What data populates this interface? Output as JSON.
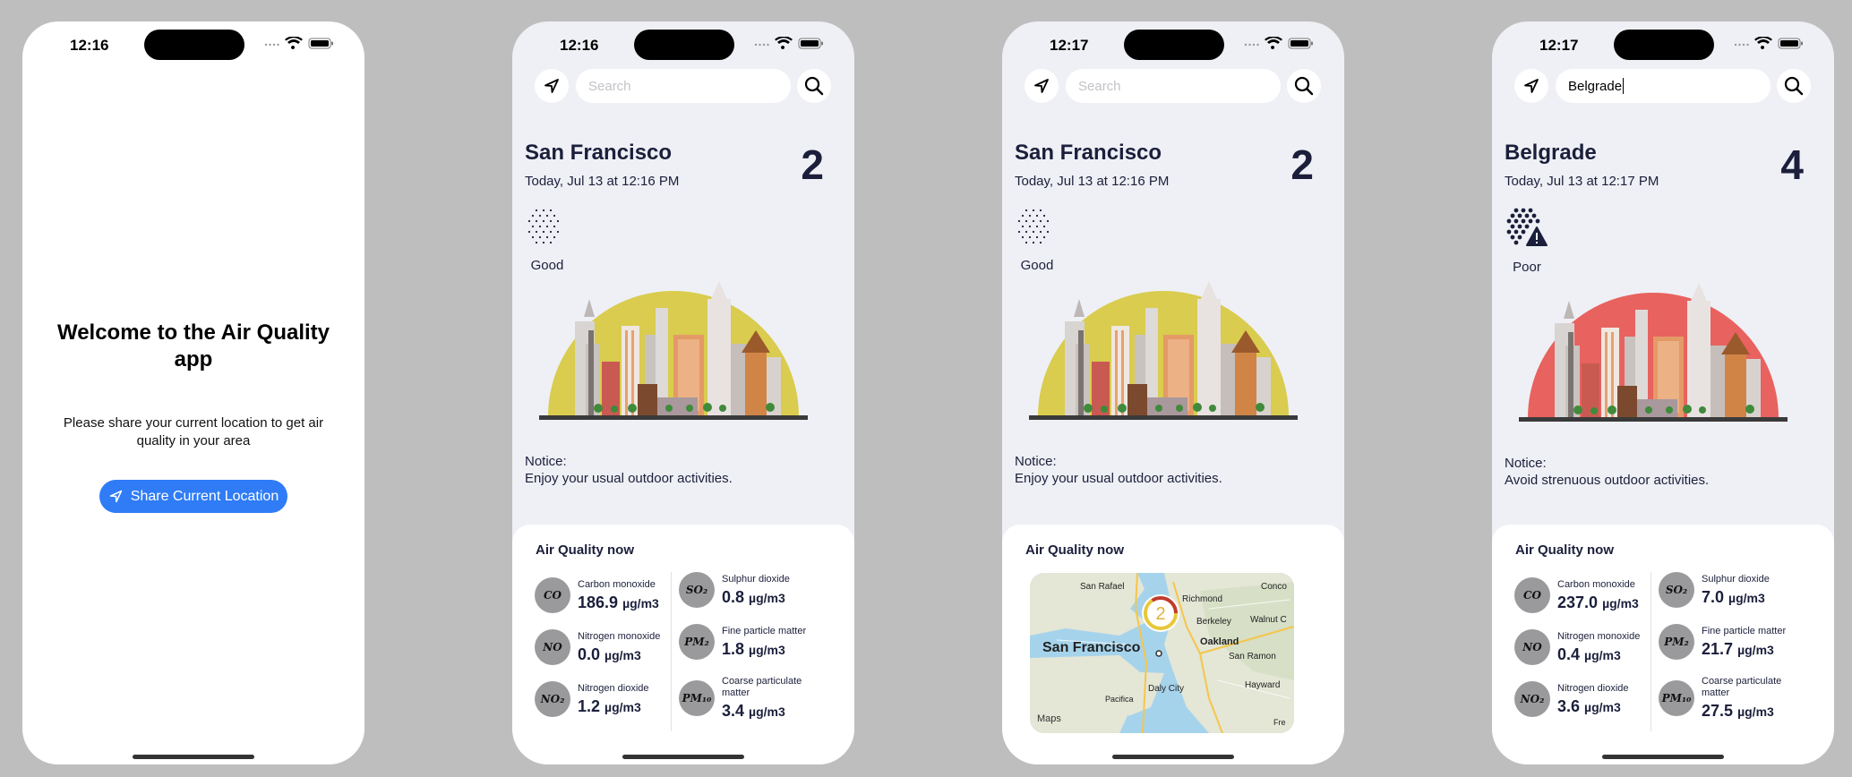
{
  "screens": [
    {
      "time": "12:16",
      "welcome_title": "Welcome to the Air Quality app",
      "welcome_subtitle": "Please share your current location to get air quality in your area",
      "share_button": "Share Current Location"
    },
    {
      "time": "12:16",
      "search_placeholder": "Search",
      "search_value": "",
      "city": "San Francisco",
      "date": "Today, Jul 13 at 12:16 PM",
      "aqi": "2",
      "quality_label": "Good",
      "notice_title": "Notice:",
      "notice_text": "Enjoy your usual outdoor activities.",
      "card_title": "Air Quality now",
      "pollutants": [
        {
          "symbol": "CO",
          "name": "Carbon monoxide",
          "value": "186.9",
          "unit": "µg/m3"
        },
        {
          "symbol": "NO",
          "name": "Nitrogen monoxide",
          "value": "0.0",
          "unit": "µg/m3"
        },
        {
          "symbol": "NO₂",
          "name": "Nitrogen dioxide",
          "value": "1.2",
          "unit": "µg/m3"
        },
        {
          "symbol": "SO₂",
          "name": "Sulphur dioxide",
          "value": "0.8",
          "unit": "µg/m3"
        },
        {
          "symbol": "PM₂",
          "name": "Fine particle matter",
          "value": "1.8",
          "unit": "µg/m3"
        },
        {
          "symbol": "PM₁₀",
          "name": "Coarse particulate matter",
          "value": "3.4",
          "unit": "µg/m3"
        }
      ]
    },
    {
      "time": "12:17",
      "search_placeholder": "Search",
      "city": "San Francisco",
      "date": "Today, Jul 13 at 12:16 PM",
      "aqi": "2",
      "quality_label": "Good",
      "notice_title": "Notice:",
      "notice_text": "Enjoy your usual outdoor activities.",
      "card_title": "Air Quality now",
      "map": {
        "marker_value": "2",
        "labels": [
          "San Rafael",
          "Richmond",
          "Conco",
          "Berkeley",
          "Walnut C",
          "Oakland",
          "San Francisco",
          "San Ramon",
          "Daly City",
          "Hayward",
          "Pacifica",
          "Fre"
        ],
        "attribution": "Maps"
      }
    },
    {
      "time": "12:17",
      "search_value": "Belgrade",
      "city": "Belgrade",
      "date": "Today, Jul 13 at 12:17 PM",
      "aqi": "4",
      "quality_label": "Poor",
      "notice_title": "Notice:",
      "notice_text": "Avoid strenuous outdoor activities.",
      "card_title": "Air Quality now",
      "pollutants": [
        {
          "symbol": "CO",
          "name": "Carbon monoxide",
          "value": "237.0",
          "unit": "µg/m3"
        },
        {
          "symbol": "NO",
          "name": "Nitrogen monoxide",
          "value": "0.4",
          "unit": "µg/m3"
        },
        {
          "symbol": "NO₂",
          "name": "Nitrogen dioxide",
          "value": "3.6",
          "unit": "µg/m3"
        },
        {
          "symbol": "SO₂",
          "name": "Sulphur dioxide",
          "value": "7.0",
          "unit": "µg/m3"
        },
        {
          "symbol": "PM₂",
          "name": "Fine particle matter",
          "value": "21.7",
          "unit": "µg/m3"
        },
        {
          "symbol": "PM₁₀",
          "name": "Coarse particulate matter",
          "value": "27.5",
          "unit": "µg/m3"
        }
      ]
    }
  ],
  "colors": {
    "good_sun": "#d9cc4f",
    "poor_sun": "#e8625f",
    "button_blue": "#2f7cf6",
    "text_dark": "#1b1f3b",
    "background": "#bebebe"
  }
}
